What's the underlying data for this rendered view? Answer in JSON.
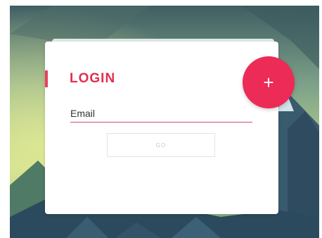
{
  "login_card": {
    "title": "LOGIN",
    "email_label": "Email",
    "go_label": "GO"
  },
  "fab": {
    "label": "+",
    "icon": "plus-icon"
  },
  "colors": {
    "accent": "#e32e50",
    "fab": "#ec2b57",
    "sky_top": "#3f5e63",
    "sky_glow": "#c9d98c",
    "mountain_dark": "#2c4a5d"
  }
}
